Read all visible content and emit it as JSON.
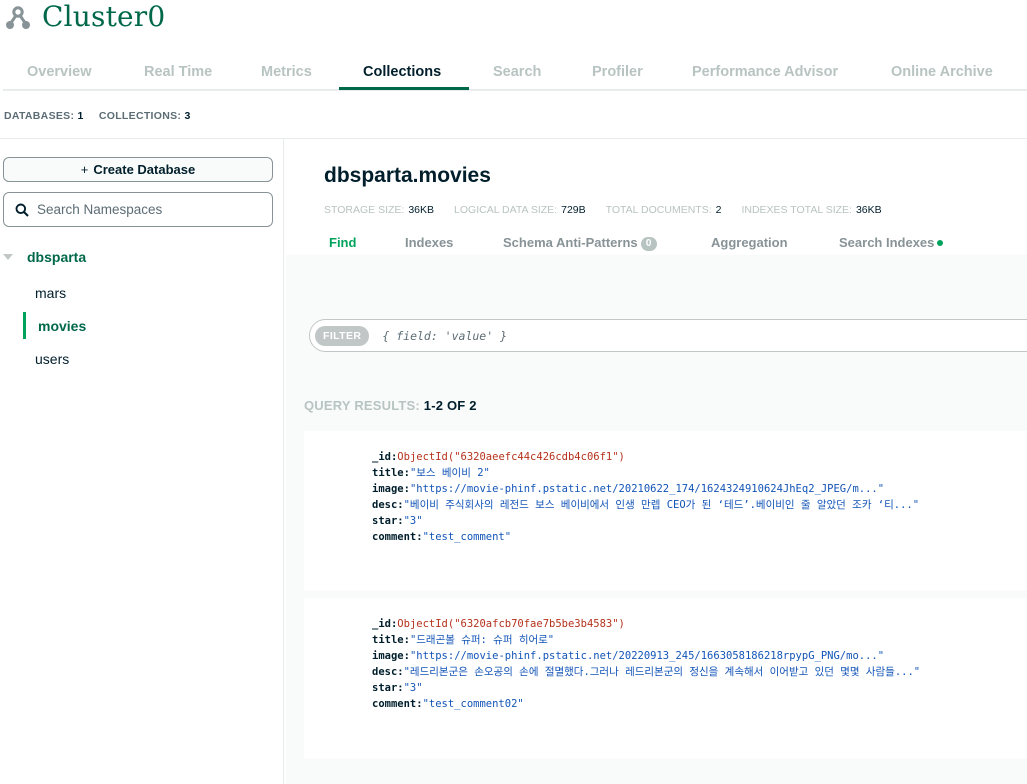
{
  "cluster": {
    "title": "Cluster0"
  },
  "tabs": [
    "Overview",
    "Real Time",
    "Metrics",
    "Collections",
    "Search",
    "Profiler",
    "Performance Advisor",
    "Online Archive"
  ],
  "active_tab": "Collections",
  "counts": {
    "databases_label": "DATABASES:",
    "databases_value": "1",
    "collections_label": "COLLECTIONS:",
    "collections_value": "3"
  },
  "sidebar": {
    "create_label": "Create Database",
    "search_placeholder": "Search Namespaces",
    "database": "dbsparta",
    "collections": [
      "mars",
      "movies",
      "users"
    ],
    "active_collection": "movies"
  },
  "namespace": {
    "title": "dbsparta.movies",
    "stats": [
      {
        "label": "STORAGE SIZE:",
        "value": "36KB"
      },
      {
        "label": "LOGICAL DATA SIZE:",
        "value": "729B"
      },
      {
        "label": "TOTAL DOCUMENTS:",
        "value": "2"
      },
      {
        "label": "INDEXES TOTAL SIZE:",
        "value": "36KB"
      }
    ]
  },
  "subtabs": {
    "find": "Find",
    "indexes": "Indexes",
    "schema": "Schema Anti-Patterns",
    "schema_badge": "0",
    "aggregation": "Aggregation",
    "search_indexes": "Search Indexes"
  },
  "filter": {
    "chip": "FILTER",
    "placeholder": "{ field: 'value' }"
  },
  "results": {
    "label": "QUERY RESULTS:",
    "count": "1-2 OF 2"
  },
  "documents": [
    {
      "id_key": "_id:",
      "id_val": "ObjectId(\"6320aeefc44c426cdb4c06f1\")",
      "title_key": "title:",
      "title_val": "\"보스 베이비 2\"",
      "image_key": "image:",
      "image_val": "\"https://movie-phinf.pstatic.net/20210622_174/1624324910624JhEq2_JPEG/m...\"",
      "desc_key": "desc:",
      "desc_val": "\"베이비 주식회사의 레전드 보스 베이비에서 인생 만렙 CEO가 된 ‘테드’.베이비인 줄 알았던 조카 ‘티...\"",
      "star_key": "star:",
      "star_val": "\"3\"",
      "comment_key": "comment:",
      "comment_val": "\"test_comment\""
    },
    {
      "id_key": "_id:",
      "id_val": "ObjectId(\"6320afcb70fae7b5be3b4583\")",
      "title_key": "title:",
      "title_val": "\"드래곤볼 슈퍼: 슈퍼 히어로\"",
      "image_key": "image:",
      "image_val": "\"https://movie-phinf.pstatic.net/20220913_245/1663058186218rpypG_PNG/mo...\"",
      "desc_key": "desc:",
      "desc_val": "\"레드리본군은 손오공의 손에 절멸했다.그러나 레드리본군의 정신을 계속해서 이어받고 있던 몇몇 사람들...\"",
      "star_key": "star:",
      "star_val": "\"3\"",
      "comment_key": "comment:",
      "comment_val": "\"test_comment02\""
    }
  ],
  "colors": {
    "brand_green": "#00684a",
    "accent_green": "#00a35c",
    "object_id": "#b5311b",
    "string": "#1254b7"
  },
  "icons": {
    "cluster": "cluster-nodes-icon",
    "search": "magnifier-icon",
    "caret": "caret-down-icon"
  }
}
